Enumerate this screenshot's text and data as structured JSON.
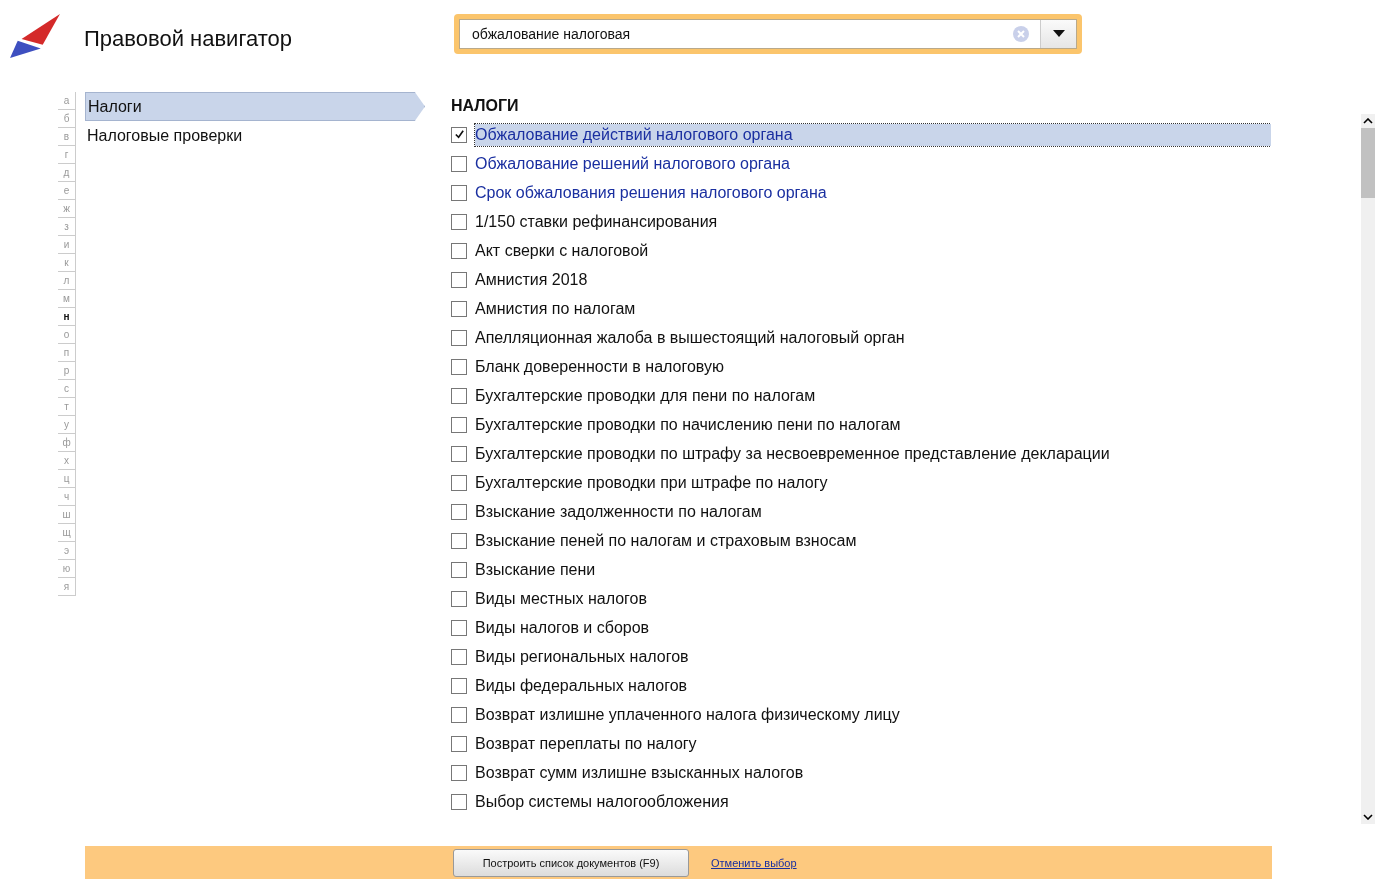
{
  "header": {
    "title": "Правовой навигатор",
    "search": {
      "value": "обжалование налоговая"
    }
  },
  "alphabet": [
    {
      "letter": "а",
      "selected": false
    },
    {
      "letter": "б",
      "selected": false
    },
    {
      "letter": "в",
      "selected": false
    },
    {
      "letter": "г",
      "selected": false
    },
    {
      "letter": "д",
      "selected": false
    },
    {
      "letter": "е",
      "selected": false
    },
    {
      "letter": "ж",
      "selected": false
    },
    {
      "letter": "з",
      "selected": false
    },
    {
      "letter": "и",
      "selected": false
    },
    {
      "letter": "к",
      "selected": false
    },
    {
      "letter": "л",
      "selected": false
    },
    {
      "letter": "м",
      "selected": false
    },
    {
      "letter": "н",
      "selected": true
    },
    {
      "letter": "о",
      "selected": false
    },
    {
      "letter": "п",
      "selected": false
    },
    {
      "letter": "р",
      "selected": false
    },
    {
      "letter": "с",
      "selected": false
    },
    {
      "letter": "т",
      "selected": false
    },
    {
      "letter": "у",
      "selected": false
    },
    {
      "letter": "ф",
      "selected": false
    },
    {
      "letter": "х",
      "selected": false
    },
    {
      "letter": "ц",
      "selected": false
    },
    {
      "letter": "ч",
      "selected": false
    },
    {
      "letter": "ш",
      "selected": false
    },
    {
      "letter": "щ",
      "selected": false
    },
    {
      "letter": "э",
      "selected": false
    },
    {
      "letter": "ю",
      "selected": false
    },
    {
      "letter": "я",
      "selected": false
    }
  ],
  "sidebar": {
    "items": [
      {
        "label": "Налоги",
        "selected": true
      },
      {
        "label": "Налоговые проверки",
        "selected": false
      }
    ]
  },
  "content": {
    "heading": "НАЛОГИ",
    "items": [
      {
        "label": "Обжалование действий налогового органа",
        "kind": "match",
        "checked": true,
        "selected": true
      },
      {
        "label": "Обжалование решений налогового органа",
        "kind": "match",
        "checked": false,
        "selected": false
      },
      {
        "label": "Срок обжалования решения налогового органа",
        "kind": "match",
        "checked": false,
        "selected": false
      },
      {
        "label": "1/150 ставки рефинансирования",
        "kind": "plain",
        "checked": false,
        "selected": false
      },
      {
        "label": "Акт сверки с налоговой",
        "kind": "plain",
        "checked": false,
        "selected": false
      },
      {
        "label": "Амнистия 2018",
        "kind": "plain",
        "checked": false,
        "selected": false
      },
      {
        "label": "Амнистия по налогам",
        "kind": "plain",
        "checked": false,
        "selected": false
      },
      {
        "label": "Апелляционная жалоба в вышестоящий налоговый орган",
        "kind": "plain",
        "checked": false,
        "selected": false
      },
      {
        "label": "Бланк доверенности в налоговую",
        "kind": "plain",
        "checked": false,
        "selected": false
      },
      {
        "label": "Бухгалтерские проводки для пени по налогам",
        "kind": "plain",
        "checked": false,
        "selected": false
      },
      {
        "label": "Бухгалтерские проводки по начислению пени по налогам",
        "kind": "plain",
        "checked": false,
        "selected": false
      },
      {
        "label": "Бухгалтерские проводки по штрафу за несвоевременное представление декларации",
        "kind": "plain",
        "checked": false,
        "selected": false
      },
      {
        "label": "Бухгалтерские проводки при штрафе по налогу",
        "kind": "plain",
        "checked": false,
        "selected": false
      },
      {
        "label": "Взыскание задолженности по налогам",
        "kind": "plain",
        "checked": false,
        "selected": false
      },
      {
        "label": "Взыскание пеней по налогам и страховым взносам",
        "kind": "plain",
        "checked": false,
        "selected": false
      },
      {
        "label": "Взыскание пени",
        "kind": "plain",
        "checked": false,
        "selected": false
      },
      {
        "label": "Виды местных налогов",
        "kind": "plain",
        "checked": false,
        "selected": false
      },
      {
        "label": "Виды налогов и сборов",
        "kind": "plain",
        "checked": false,
        "selected": false
      },
      {
        "label": "Виды региональных налогов",
        "kind": "plain",
        "checked": false,
        "selected": false
      },
      {
        "label": "Виды федеральных налогов",
        "kind": "plain",
        "checked": false,
        "selected": false
      },
      {
        "label": "Возврат излишне уплаченного налога физическому лицу",
        "kind": "plain",
        "checked": false,
        "selected": false
      },
      {
        "label": "Возврат переплаты по налогу",
        "kind": "plain",
        "checked": false,
        "selected": false
      },
      {
        "label": "Возврат сумм излишне взысканных налогов",
        "kind": "plain",
        "checked": false,
        "selected": false
      },
      {
        "label": "Выбор системы налогообложения",
        "kind": "plain",
        "checked": false,
        "selected": false
      }
    ]
  },
  "footer": {
    "build_button": "Построить список документов (F9)",
    "cancel_link": "Отменить выбор"
  }
}
